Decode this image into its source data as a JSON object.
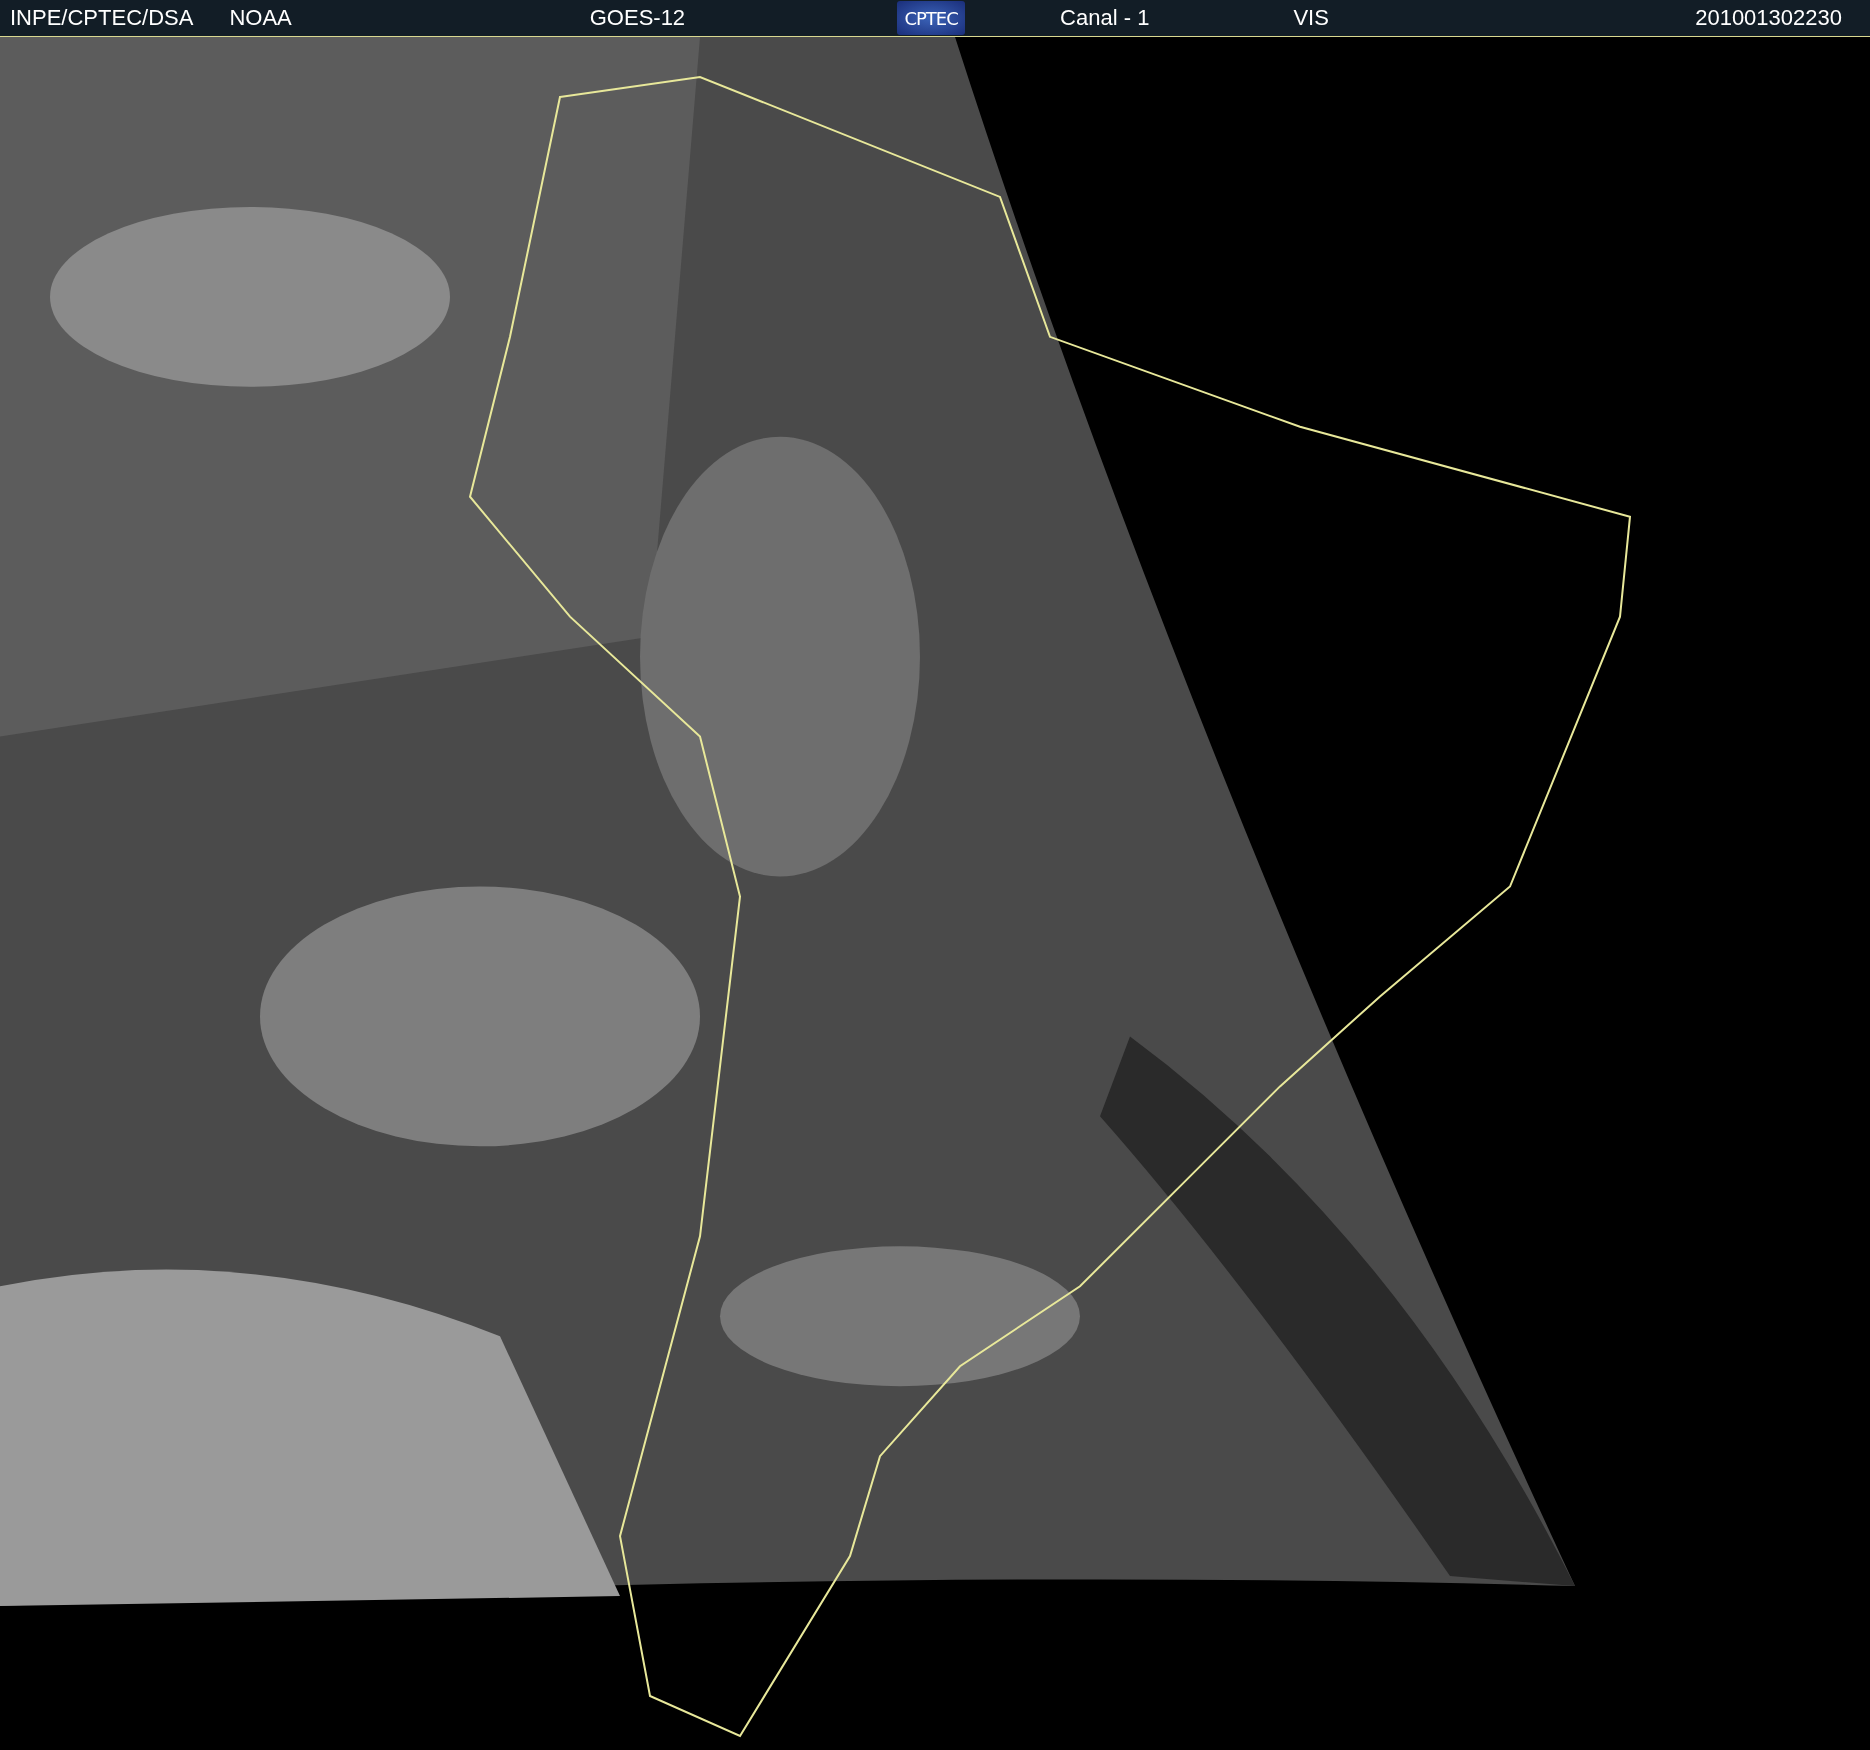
{
  "header": {
    "source": "INPE/CPTEC/DSA",
    "agency": "NOAA",
    "satellite": "GOES-12",
    "logo": "CPTEC",
    "channel": "Canal - 1",
    "band": "VIS",
    "timestamp": "201001302230"
  }
}
